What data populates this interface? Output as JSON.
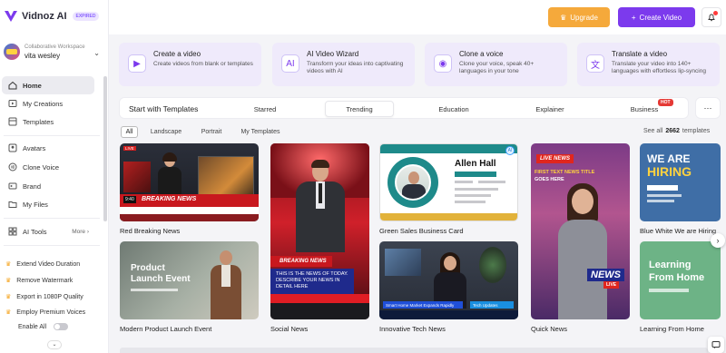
{
  "app": {
    "brand": "Vidnoz AI",
    "badge": "EXPIRED",
    "accent": "#7c3aed",
    "upgrade_color": "#f5a93b"
  },
  "workspace": {
    "label": "Collaborative Workspace",
    "name": "vita wesley"
  },
  "sidebar": {
    "items": [
      {
        "label": "Home",
        "icon": "home-icon"
      },
      {
        "label": "My Creations",
        "icon": "creations-icon"
      },
      {
        "label": "Templates",
        "icon": "templates-icon"
      },
      {
        "label": "Avatars",
        "icon": "avatar-icon"
      },
      {
        "label": "Clone Voice",
        "icon": "voice-icon"
      },
      {
        "label": "Brand",
        "icon": "brand-icon"
      },
      {
        "label": "My Files",
        "icon": "folder-icon"
      },
      {
        "label": "AI Tools",
        "icon": "ai-tools-icon"
      }
    ],
    "more_label": "More",
    "perks": [
      "Extend Video Duration",
      "Remove Watermark",
      "Export in 1080P Quality",
      "Employ Premium Voices"
    ],
    "enable_all": "Enable All"
  },
  "topbar": {
    "upgrade_label": "Upgrade",
    "create_label": "Create Video"
  },
  "features": [
    {
      "title": "Create a video",
      "desc": "Create videos from blank or templates",
      "icon": "play-plus-icon"
    },
    {
      "title": "AI Video Wizard",
      "desc": "Transform your ideas into captivating videos with AI",
      "icon": "ai-wizard-icon"
    },
    {
      "title": "Clone a voice",
      "desc": "Clone your voice, speak 40+ languages in your tone",
      "icon": "clone-voice-icon"
    },
    {
      "title": "Translate a video",
      "desc": "Translate your video into 140+ languages with effortless lip-syncing",
      "icon": "translate-icon"
    }
  ],
  "templates": {
    "heading": "Start with Templates",
    "tabs": [
      "Starred",
      "Trending",
      "Education",
      "Explainer",
      "Business"
    ],
    "active_tab": "Trending",
    "hot_badge": "HOT",
    "filters": [
      "All",
      "Landscape",
      "Portrait",
      "My Templates"
    ],
    "active_filter": "All",
    "see_all_prefix": "See all",
    "count": "2662",
    "see_all_suffix": "templates",
    "cards": [
      {
        "label": "Red Breaking News"
      },
      {
        "label": "Modern Product Launch Event"
      },
      {
        "label": "Social News"
      },
      {
        "label": "Green Sales Business Card"
      },
      {
        "label": "Innovative Tech News"
      },
      {
        "label": "Quick News"
      },
      {
        "label": "Blue White We are Hiring"
      },
      {
        "label": "Learning From Home"
      }
    ],
    "art": {
      "breaking_news": "BREAKING NEWS",
      "live": "LIVE",
      "time": "9:40",
      "product_launch_1": "Product",
      "product_launch_2": "Launch Event",
      "social_breaking": "BREAKING NEWS",
      "social_box": "THIS IS THE NEWS OF TODAY. DESCRIBE YOUR NEWS IN DETAIL HERE",
      "card_name": "Allen Hall",
      "tech_bar": "Smart Home Market Expands Rapidly",
      "tech_bar2": "Tech Updates",
      "quick_live": "LIVE NEWS",
      "quick_t1": "FIRST TEXT NEWS TITLE",
      "quick_t2": "GOES HERE",
      "quick_news": "NEWS",
      "quick_live2": "LIVE",
      "we": "WE ARE",
      "hiring": "HIRING",
      "learning1": "Learning",
      "learning2": "From Home"
    }
  }
}
